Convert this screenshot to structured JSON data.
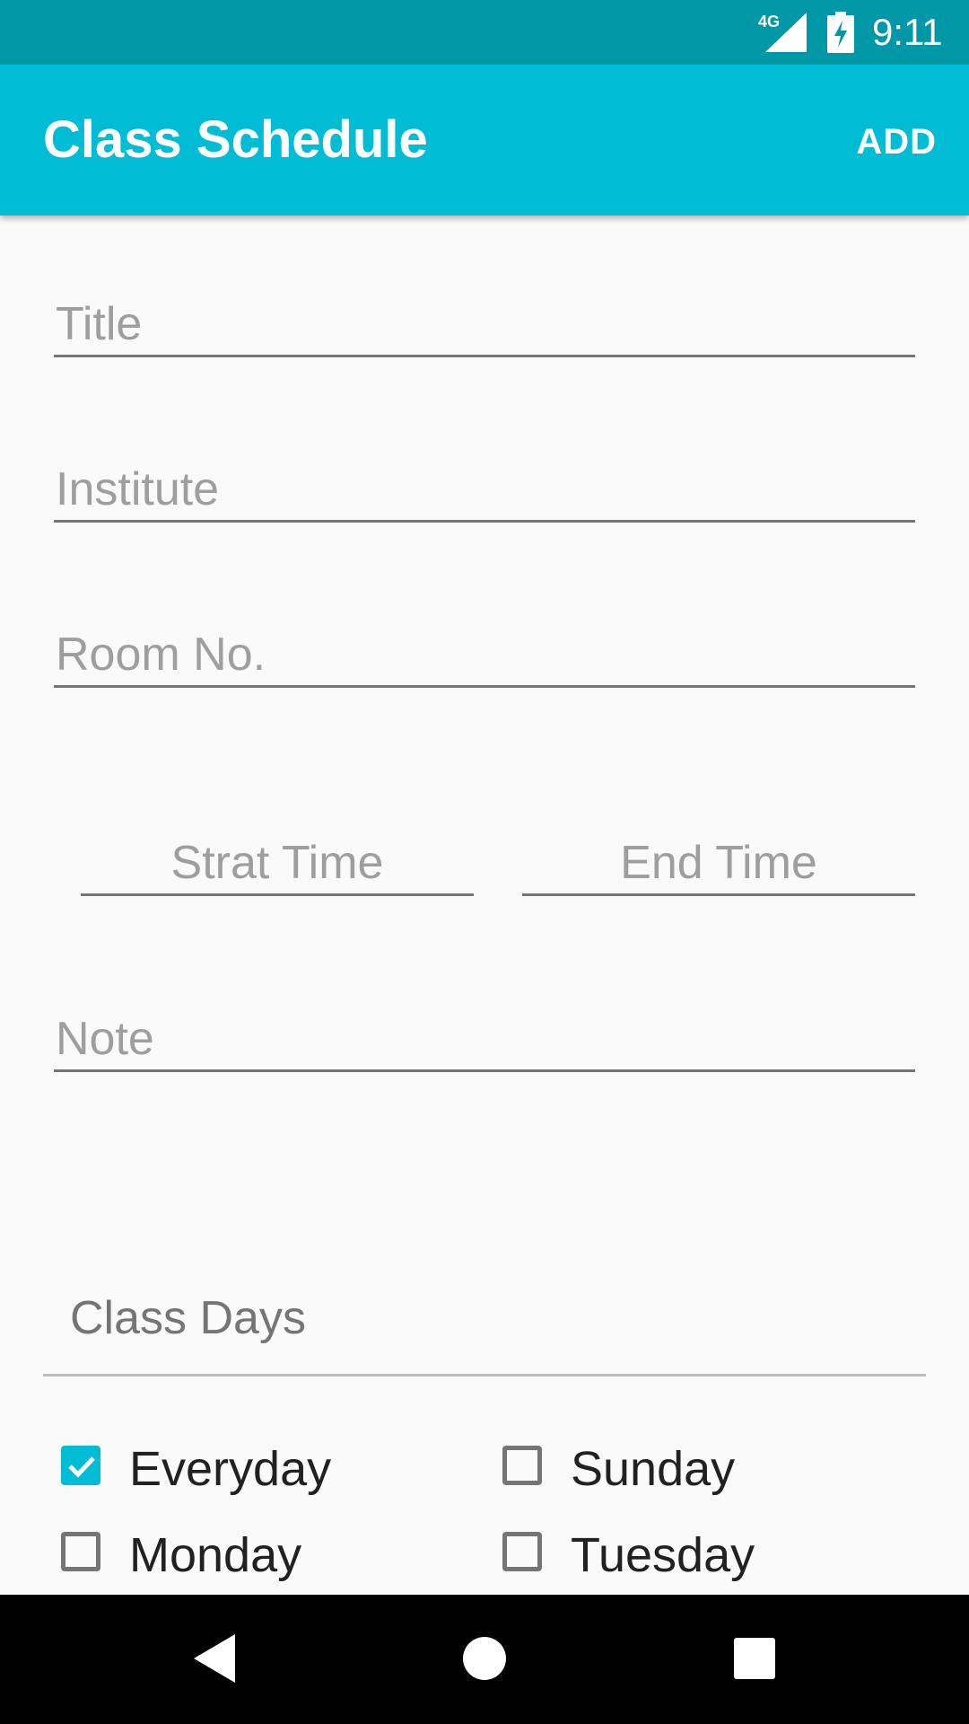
{
  "status_bar": {
    "network": "4G",
    "time": "9:11",
    "icons": [
      "signal-icon",
      "battery-charging-icon"
    ]
  },
  "app_bar": {
    "title": "Class Schedule",
    "action_label": "ADD",
    "color": "#00bcd4"
  },
  "form": {
    "title": {
      "placeholder": "Title",
      "value": ""
    },
    "institute": {
      "placeholder": "Institute",
      "value": ""
    },
    "room": {
      "placeholder": "Room No.",
      "value": ""
    },
    "start_time": {
      "placeholder": "Strat Time",
      "value": ""
    },
    "end_time": {
      "placeholder": "End Time",
      "value": ""
    },
    "note": {
      "placeholder": "Note",
      "value": ""
    }
  },
  "class_days": {
    "label": "Class Days",
    "options": [
      {
        "label": "Everyday",
        "checked": true
      },
      {
        "label": "Sunday",
        "checked": false
      },
      {
        "label": "Monday",
        "checked": false
      },
      {
        "label": "Tuesday",
        "checked": false
      }
    ]
  },
  "nav_bar": {
    "icons": [
      "back-icon",
      "home-icon",
      "recents-icon"
    ]
  }
}
